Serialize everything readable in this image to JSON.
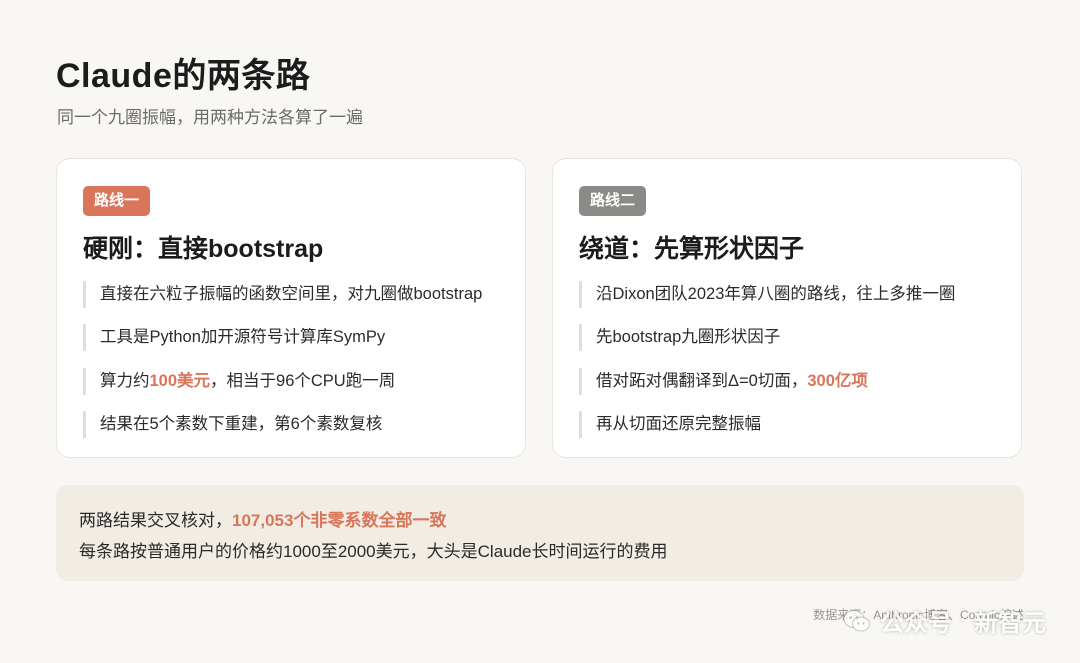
{
  "header": {
    "title": "Claude的两条路",
    "subtitle": "同一个九圈振幅，用两种方法各算了一遍"
  },
  "cards": [
    {
      "badge": "路线一",
      "heading": "硬刚：直接bootstrap",
      "bullets": [
        {
          "text": "直接在六粒子振幅的函数空间里，对九圈做bootstrap"
        },
        {
          "text": "工具是Python加开源符号计算库SymPy"
        },
        {
          "pre": "算力约",
          "hl": "100美元",
          "post": "，相当于96个CPU跑一周"
        },
        {
          "text": "结果在5个素数下重建，第6个素数复核"
        }
      ]
    },
    {
      "badge": "路线二",
      "heading": "绕道：先算形状因子",
      "bullets": [
        {
          "text": "沿Dixon团队2023年算八圈的路线，往上多推一圈"
        },
        {
          "text": "先bootstrap九圈形状因子"
        },
        {
          "pre": "借对跖对偶翻译到Δ=0切面，",
          "hl": "300亿项",
          "post": ""
        },
        {
          "text": "再从切面还原完整振幅"
        }
      ]
    }
  ],
  "summary": {
    "line1_pre": "两路结果交叉核对，",
    "line1_hl": "107,053个非零系数全部一致",
    "line2": "每条路按普通用户的价格约1000至2000美元，大头是Claude长时间运行的费用"
  },
  "footer": {
    "source": "数据来源：Anthropic博客、Cosmic综述",
    "watermark_left": "公众号",
    "watermark_dot": "·",
    "watermark_right": "新智元"
  },
  "colors": {
    "accent": "#d9765a",
    "badge_gray": "#8a8a86",
    "background": "#f9f7f3",
    "summary_bg": "#f1ece4"
  }
}
